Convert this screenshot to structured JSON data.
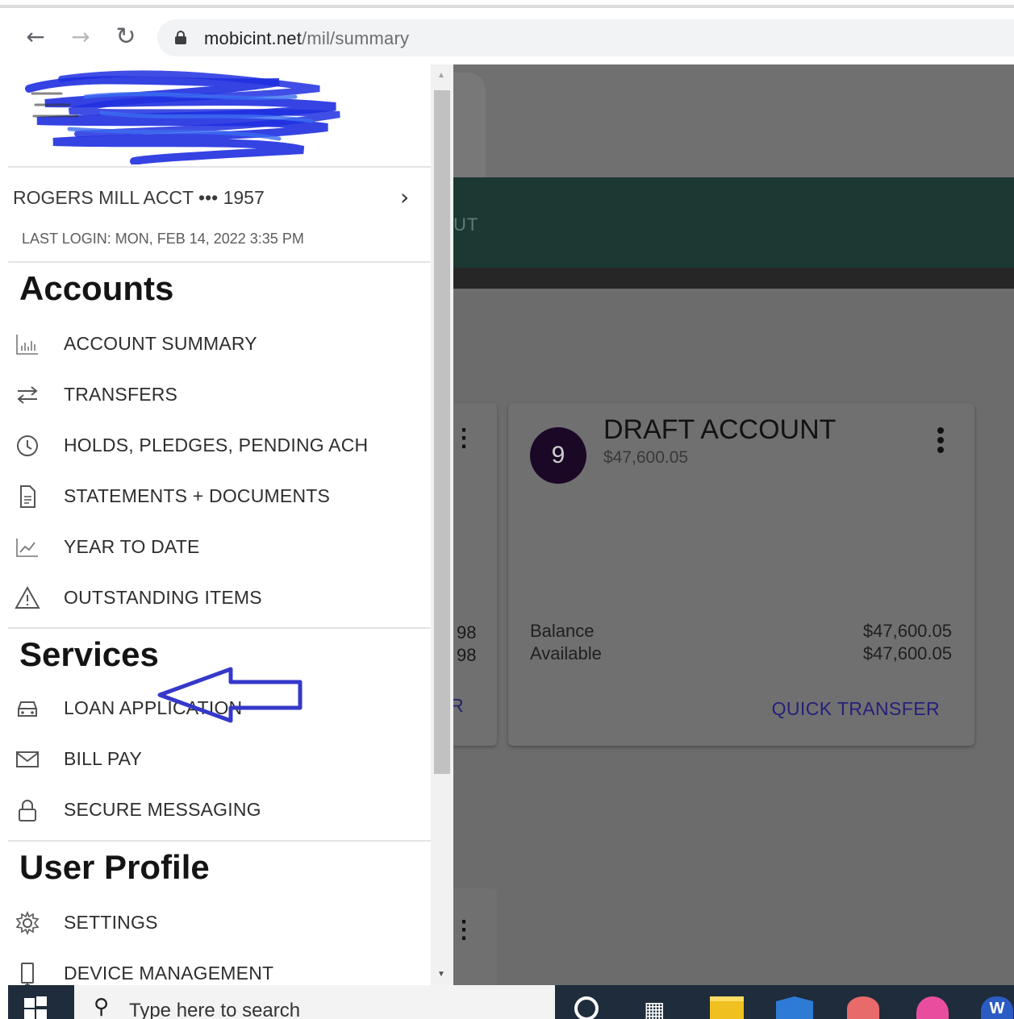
{
  "browser": {
    "url_domain": "mobicint.net",
    "url_path": "/mil/summary",
    "back_icon": "arrow-left-icon",
    "forward_icon": "arrow-right-icon",
    "reload_icon": "reload-icon",
    "secure_icon": "lock-icon"
  },
  "drawer": {
    "account_label": "ROGERS MILL ACCT ••• 1957",
    "last_login": "LAST LOGIN: MON, FEB 14, 2022 3:35 PM",
    "sections": {
      "accounts": {
        "title": "Accounts",
        "items": [
          {
            "label": "ACCOUNT SUMMARY",
            "icon": "bar-chart-icon"
          },
          {
            "label": "TRANSFERS",
            "icon": "transfer-arrows-icon"
          },
          {
            "label": "HOLDS, PLEDGES, PENDING ACH",
            "icon": "clock-icon"
          },
          {
            "label": "STATEMENTS + DOCUMENTS",
            "icon": "document-icon"
          },
          {
            "label": "YEAR TO DATE",
            "icon": "trend-chart-icon"
          },
          {
            "label": "OUTSTANDING ITEMS",
            "icon": "warning-icon"
          }
        ]
      },
      "services": {
        "title": "Services",
        "items": [
          {
            "label": "LOAN APPLICATION",
            "icon": "car-icon"
          },
          {
            "label": "BILL PAY",
            "icon": "envelope-icon"
          },
          {
            "label": "SECURE MESSAGING",
            "icon": "lock-icon"
          }
        ]
      },
      "user_profile": {
        "title": "User Profile",
        "items": [
          {
            "label": "SETTINGS",
            "icon": "gear-icon"
          },
          {
            "label": "DEVICE MANAGEMENT",
            "icon": "device-icon"
          }
        ]
      }
    }
  },
  "background": {
    "green_bar_partial_label": "UT",
    "left_card": {
      "value_1": "98",
      "value_2": "98",
      "link_partial": "R"
    },
    "card": {
      "badge": "9",
      "name": "DRAFT ACCOUNT",
      "amount": "$47,600.05",
      "rows": [
        {
          "label": "Balance",
          "value": "$47,600.05"
        },
        {
          "label": "Available",
          "value": "$47,600.05"
        }
      ],
      "action": "QUICK TRANSFER"
    }
  },
  "taskbar": {
    "search_placeholder": "Type here to search",
    "search_icon": "search-icon",
    "word_letter": "W"
  },
  "colors": {
    "annotation_arrow": "#3538c9",
    "scribble": "#1f2fe0",
    "green_bar": "#1c3833",
    "badge": "#1a0826"
  }
}
